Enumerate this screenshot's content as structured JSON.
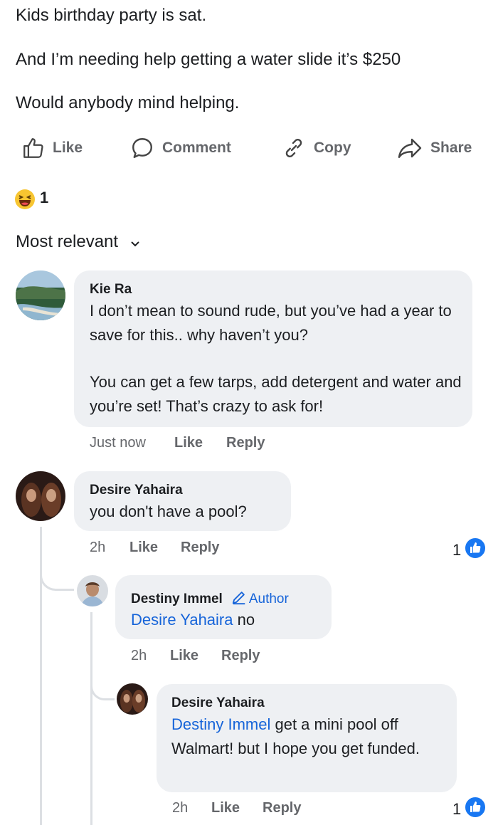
{
  "post": {
    "line1": "Kids birthday party is sat.",
    "line2": "And I’m needing help getting a water slide it’s $250",
    "line3": "Would anybody mind helping."
  },
  "actions": {
    "like": "Like",
    "comment": "Comment",
    "copy": "Copy",
    "share": "Share"
  },
  "reactions": {
    "count": "1"
  },
  "sort": {
    "label": "Most relevant"
  },
  "comments": [
    {
      "name": "Kie Ra",
      "text_p1": "I don’t mean to sound rude, but you’ve had a year to save for this.. why haven’t you?",
      "text_p2": "You can get a few tarps, add detergent and water and you’re set! That’s crazy to ask for!",
      "time": "Just now",
      "like": "Like",
      "reply": "Reply"
    },
    {
      "name": "Desire Yahaira",
      "text": "you don't have a pool?",
      "time": "2h",
      "like": "Like",
      "reply": "Reply",
      "like_count": "1"
    },
    {
      "name": "Destiny Immel",
      "badge": "Author",
      "tag": "Desire Yahaira",
      "text": "no",
      "time": "2h",
      "like": "Like",
      "reply": "Reply"
    },
    {
      "name": "Desire Yahaira",
      "tag": "Destiny Immel",
      "text": "get a mini pool off Walmart! but I hope you get funded.",
      "time": "2h",
      "like": "Like",
      "reply": "Reply",
      "like_count": "1"
    }
  ],
  "colors": {
    "link": "#1664d9",
    "bubble": "#eef0f3",
    "meta": "#65676b",
    "like_badge": "#1877f2"
  }
}
